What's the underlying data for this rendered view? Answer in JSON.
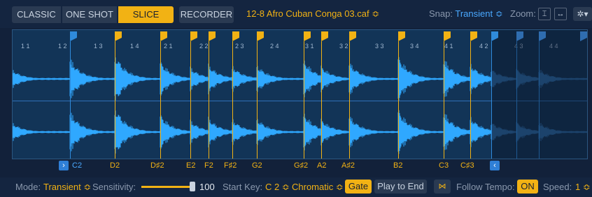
{
  "header": {
    "modes": [
      "CLASSIC",
      "ONE SHOT",
      "SLICE"
    ],
    "active_mode": "SLICE",
    "recorder_label": "RECORDER",
    "filename": "12-8 Afro Cuban Conga 03.caf ≎",
    "snap_label": "Snap:",
    "snap_value": "Transient ≎",
    "zoom_label": "Zoom:",
    "zoom_icons": [
      "zoom-vertical-icon",
      "zoom-horizontal-icon"
    ],
    "settings_icon": "gear-icon",
    "settings_glyph": "✲▾"
  },
  "ruler": [
    "1 1",
    "1 2",
    "1 3",
    "1 4",
    "2 1",
    "2 2",
    "2 3",
    "2 4",
    "3 1",
    "3 2",
    "3 3",
    "3 4",
    "4 1",
    "4 2",
    "4 3",
    "4 4"
  ],
  "slices": {
    "notes": [
      "C2",
      "D2",
      "D♯2",
      "E2",
      "F2",
      "F♯2",
      "G2",
      "G♯2",
      "A2",
      "A♯2",
      "B2",
      "C3",
      "C♯3"
    ],
    "prev_glyph": "›",
    "next_glyph": "‹"
  },
  "footer": {
    "mode_label": "Mode:",
    "mode_value": "Transient ≎",
    "sensitivity_label": "Sensitivity:",
    "sensitivity_value": "100",
    "start_key_label": "Start Key:",
    "start_key_value": "C 2 ≎",
    "scale_value": "Chromatic ≎",
    "gate_label": "Gate",
    "play_to_end_label": "Play to End",
    "reverse_glyph": "⋈",
    "follow_tempo_label": "Follow Tempo:",
    "follow_tempo_value": "ON",
    "speed_label": "Speed:",
    "speed_value": "1 ≎"
  },
  "colors": {
    "accent": "#f2b214",
    "wave": "#2fa8ff",
    "background": "#12213a"
  }
}
